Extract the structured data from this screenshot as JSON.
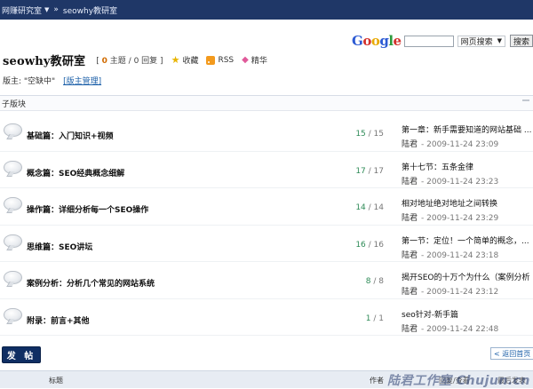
{
  "breadcrumb": {
    "home": "网赚研究室",
    "current": "seowhy教研室",
    "sep": "»"
  },
  "header": {
    "title": "seowhy教研室",
    "topics": "0",
    "topics_label": "主题",
    "posts": "0",
    "posts_label": "回复",
    "favorite": "收藏",
    "rss": "RSS",
    "digest": "精华"
  },
  "moderator": {
    "label": "版主: \"空缺中\"",
    "apply": "[版主管理]"
  },
  "google": {
    "logo": [
      "G",
      "o",
      "o",
      "g",
      "l",
      "e"
    ],
    "select": "网页搜索",
    "button": "搜索"
  },
  "section": {
    "label": "子版块"
  },
  "forums": [
    {
      "name": "基础篇：入门知识+视频",
      "topics": "15",
      "posts": "15",
      "last_title": "第一章：新手需要知道的网站基础 ...",
      "last_user": "陆君",
      "last_time": "- 2009-11-24 23:09"
    },
    {
      "name": "概念篇：SEO经典概念细解",
      "topics": "17",
      "posts": "17",
      "last_title": "第十七节：五条金律",
      "last_user": "陆君",
      "last_time": "- 2009-11-24 23:23"
    },
    {
      "name": "操作篇：详细分析每一个SEO操作",
      "topics": "14",
      "posts": "14",
      "last_title": "相对地址绝对地址之间转换",
      "last_user": "陆君",
      "last_time": "- 2009-11-24 23:29"
    },
    {
      "name": "思维篇：SEO讲坛",
      "topics": "16",
      "posts": "16",
      "last_title": "第一节：定位！一个简单的概念，...",
      "last_user": "陆君",
      "last_time": "- 2009-11-24 23:18"
    },
    {
      "name": "案例分析：分析几个常见的网站系统",
      "topics": "8",
      "posts": "8",
      "last_title": "揭开SEO的十万个为什么（案例分析 ...",
      "last_user": "陆君",
      "last_time": "- 2009-11-24 23:12"
    },
    {
      "name": "附录：前言+其他",
      "topics": "1",
      "posts": "1",
      "last_title": "seo针对-新手篇",
      "last_user": "陆君",
      "last_time": "- 2009-11-24 22:48"
    }
  ],
  "actions": {
    "post": "发 帖",
    "back": "< 返回首页"
  },
  "list_header": {
    "title": "标题",
    "author": "作者",
    "reply": "回复/查看",
    "last": "最后发表"
  },
  "watermark": "陆君工作室 Chujun.cn"
}
